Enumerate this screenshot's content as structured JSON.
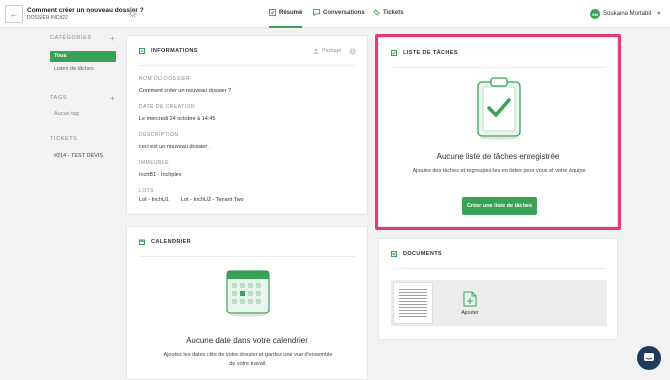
{
  "header": {
    "back_icon": "arrow-left-icon",
    "title": "Comment créer un nouveau dossier ?",
    "subtitle": "DOSSIER INC#22",
    "tabs": [
      {
        "label": "Résumé",
        "icon": "summary-icon",
        "active": true
      },
      {
        "label": "Conversations",
        "icon": "chat-bubble-icon",
        "active": false
      },
      {
        "label": "Tickets",
        "icon": "ticket-icon",
        "active": false
      }
    ],
    "user": {
      "initials": "SM",
      "name": "Soukaina Mortabit"
    }
  },
  "sidebar": {
    "categories": {
      "heading": "CATÉGORIES",
      "items": [
        "Tous",
        "Listes de tâches"
      ],
      "active": "Tous"
    },
    "tags": {
      "heading": "TAGS",
      "items": [
        "Aucun tag"
      ]
    },
    "tickets": {
      "heading": "TICKETS",
      "items": [
        "#214 - TEST DEVIS"
      ]
    }
  },
  "info_card": {
    "heading": "INFORMATIONS",
    "share_label": "Partagé",
    "fields": [
      {
        "label": "NOM DU DOSSIER",
        "value": "Comment créer un nouveau dossier ?"
      },
      {
        "label": "DATE DE CRÉATION",
        "value": "Le mercredi 24 octobre à 14:45"
      },
      {
        "label": "DESCRIPTION",
        "value": "ceci est un nouveau dossier ."
      },
      {
        "label": "IMMEUBLE",
        "value": "InchB1 - Inchplex"
      }
    ],
    "lots_label": "LOTS",
    "lots": [
      "Lot - InchU1",
      "Lot - InchU2 - Tenant Two"
    ]
  },
  "tasks_card": {
    "heading": "LISTE DE TÂCHES",
    "empty_title": "Aucune liste de tâches enregistrée",
    "empty_text": "Ajoutez des tâches et regroupez-les en listes pour vous et votre équipe",
    "button_label": "Créer une liste de tâches"
  },
  "calendar_card": {
    "heading": "CALENDRIER",
    "empty_title": "Aucune date dans votre calendrier",
    "empty_text": "Ajoutez les dates clés de votre dossier et gardez une vue d'ensemble de votre travail."
  },
  "documents_card": {
    "heading": "DOCUMENTS",
    "add_label": "Ajouter"
  },
  "colors": {
    "accent": "#3aa257",
    "highlight": "#e63b79",
    "chat": "#1e3a5f"
  }
}
